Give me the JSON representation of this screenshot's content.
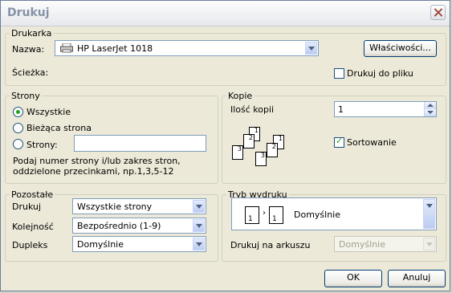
{
  "window": {
    "title": "Drukuj"
  },
  "printer": {
    "legend": "Drukarka",
    "name_label": "Nazwa:",
    "name_value": "HP LaserJet 1018",
    "path_label": "Ścieżka:",
    "properties_button": "Właściwości...",
    "print_to_file_label": "Drukuj do pliku",
    "print_to_file_checked": false
  },
  "pages": {
    "legend": "Strony",
    "all_label": "Wszystkie",
    "current_label": "Bieżąca strona",
    "pages_label": "Strony:",
    "pages_value": "",
    "hint": "Podaj numer strony i/lub zakres stron, oddzielone przecinkami, np.1,3,5-12",
    "selected": "all"
  },
  "copies": {
    "legend": "Kopie",
    "count_label": "Ilość kopii",
    "count_value": "1",
    "collate_label": "Sortowanie",
    "collate_checked": true,
    "page_numbers": [
      "1",
      "2",
      "3",
      "1",
      "2",
      "3"
    ]
  },
  "other": {
    "legend": "Pozostałe",
    "print_label": "Drukuj",
    "print_value": "Wszystkie strony",
    "order_label": "Kolejność",
    "order_value": "Bezpośrednio (1-9)",
    "duplex_label": "Dupleks",
    "duplex_value": "Domyślnie"
  },
  "print_mode": {
    "legend": "Tryb wydruku",
    "mode_value": "Domyślnie",
    "mode_page_from": "1",
    "mode_page_to": "1",
    "per_sheet_label": "Drukuj na arkuszu",
    "per_sheet_value": "Domyślnie"
  },
  "buttons": {
    "ok": "OK",
    "cancel": "Anuluj"
  }
}
